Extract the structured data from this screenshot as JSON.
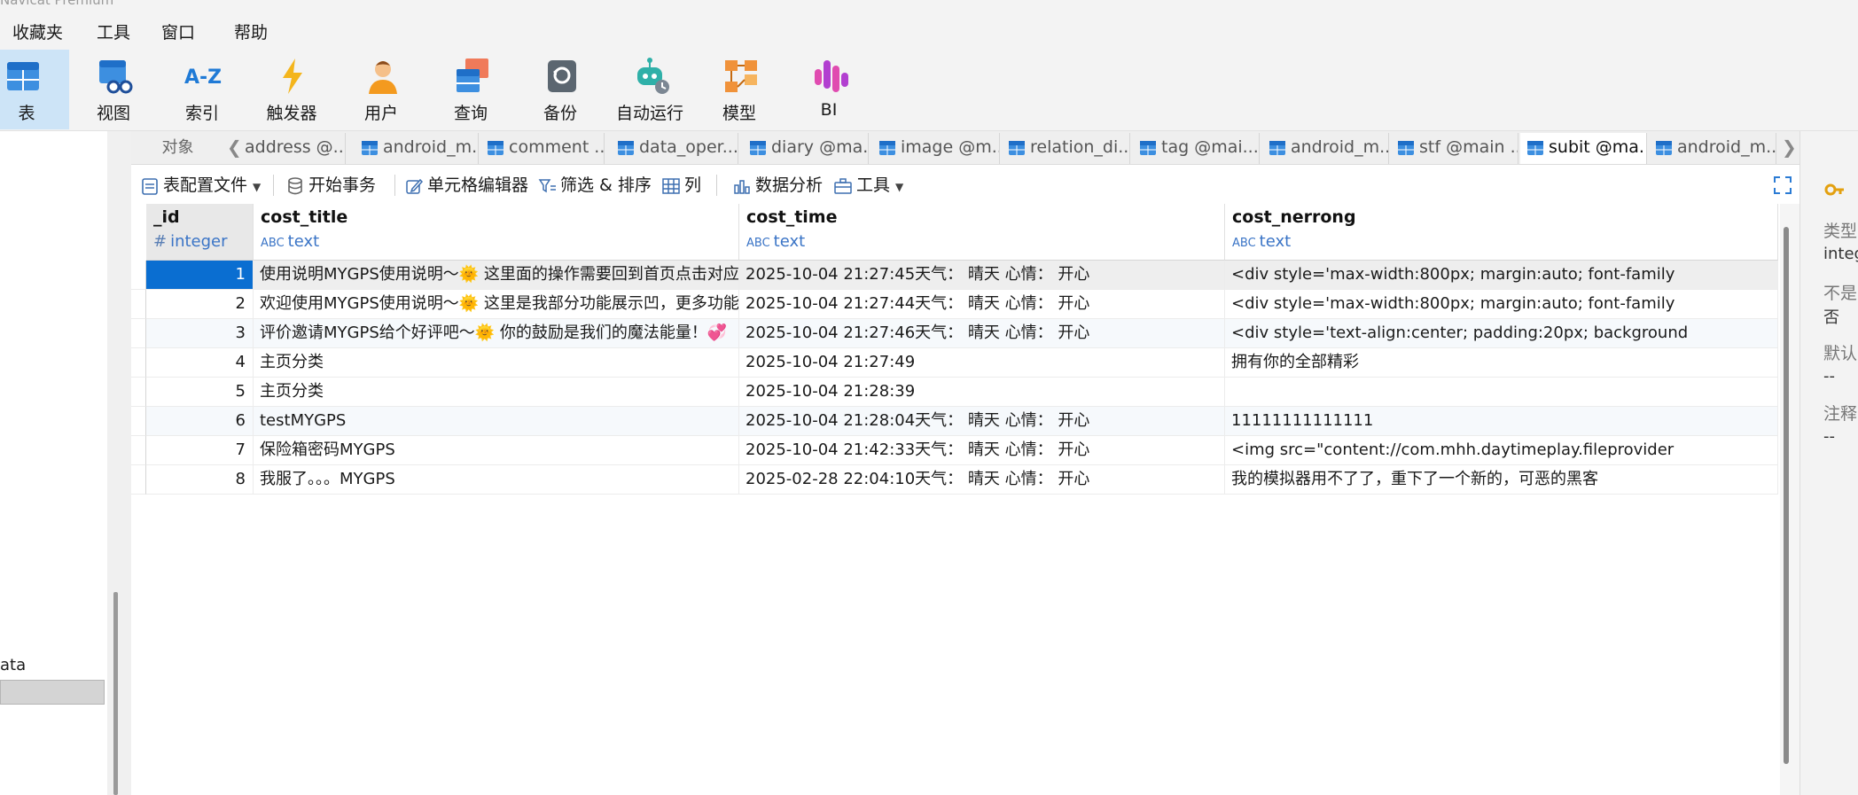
{
  "app": {
    "title": "Navicat Premium"
  },
  "menubar": {
    "items": [
      "收藏夹",
      "工具",
      "窗口",
      "帮助"
    ]
  },
  "ribbon": {
    "items": [
      {
        "label": "表",
        "icon": "table-icon",
        "active": true
      },
      {
        "label": "视图",
        "icon": "view-icon"
      },
      {
        "label": "索引",
        "icon": "index-icon"
      },
      {
        "label": "触发器",
        "icon": "trigger-icon"
      },
      {
        "label": "用户",
        "icon": "user-icon"
      },
      {
        "label": "查询",
        "icon": "query-icon"
      },
      {
        "label": "备份",
        "icon": "backup-icon"
      },
      {
        "label": "自动运行",
        "icon": "automation-icon"
      },
      {
        "label": "模型",
        "icon": "model-icon"
      },
      {
        "label": "BI",
        "icon": "bi-icon"
      }
    ]
  },
  "left_panel": {
    "text": "ata"
  },
  "tabs": {
    "objects_label": "对象",
    "items": [
      {
        "label": "address @..."
      },
      {
        "label": "android_m..."
      },
      {
        "label": "comment ..."
      },
      {
        "label": "data_oper..."
      },
      {
        "label": "diary @ma..."
      },
      {
        "label": "image @m..."
      },
      {
        "label": "relation_di..."
      },
      {
        "label": "tag @mai..."
      },
      {
        "label": "android_m..."
      },
      {
        "label": "stf @main ..."
      },
      {
        "label": "subit @ma...",
        "active": true
      },
      {
        "label": "android_m..."
      }
    ]
  },
  "toolbar": {
    "table_profile": "表配置文件",
    "begin_transaction": "开始事务",
    "cell_editor": "单元格编辑器",
    "filter_sort": "筛选 & 排序",
    "columns": "列",
    "data_analysis": "数据分析",
    "tools": "工具"
  },
  "grid": {
    "columns": [
      {
        "name": "_id",
        "type": "integer",
        "glyph": "#"
      },
      {
        "name": "cost_title",
        "type": "text",
        "glyph": "ABC"
      },
      {
        "name": "cost_time",
        "type": "text",
        "glyph": "ABC"
      },
      {
        "name": "cost_nerrong",
        "type": "text",
        "glyph": "ABC"
      }
    ],
    "rows": [
      [
        "1",
        "使用说明MYGPS使用说明～🌞 这里面的操作需要回到首页点击对应的笔记操作奥！💞",
        "2025-10-04 21:27:45天气： 晴天   心情： 开心",
        "<div style='max-width:800px; margin:auto; font-family"
      ],
      [
        "2",
        "欢迎使用MYGPS使用说明～🌞 这里是我部分功能展示凹，更多功能等待您的探索！💞",
        "2025-10-04 21:27:44天气： 晴天   心情： 开心",
        "<div style='max-width:800px; margin:auto; font-family"
      ],
      [
        "3",
        "评价邀请MYGPS给个好评吧～🌞 你的鼓励是我们的魔法能量！💞",
        "2025-10-04 21:27:46天气： 晴天   心情： 开心",
        "<div style='text-align:center; padding:20px; background"
      ],
      [
        "4",
        "主页分类",
        "2025-10-04 21:27:49",
        "拥有你的全部精彩"
      ],
      [
        "5",
        "主页分类",
        "2025-10-04 21:28:39",
        ""
      ],
      [
        "6",
        "testMYGPS",
        "2025-10-04  21:28:04天气： 晴天   心情： 开心",
        "11111111111111"
      ],
      [
        "7",
        "保险箱密码MYGPS",
        "2025-10-04  21:42:33天气： 晴天   心情： 开心",
        "<img src=\"content://com.mhh.daytimeplay.fileprovider"
      ],
      [
        "8",
        "我服了。。。MYGPS",
        "2025-02-28  22:04:10天气： 晴天   心情： 开心",
        "我的模拟器用不了了，重下了一个新的，可恶的黑客"
      ]
    ]
  },
  "right_panel": {
    "type_label": "类型",
    "type_value": "integ",
    "not_null_label": "不是",
    "not_null_value": "否",
    "default_label": "默认",
    "default_value": "--",
    "comment_label": "注释",
    "comment_value": "--"
  },
  "colors": {
    "accent": "#0a6ed1",
    "type_text": "#3a74c6",
    "ribbon_active": "#cde4f7"
  }
}
